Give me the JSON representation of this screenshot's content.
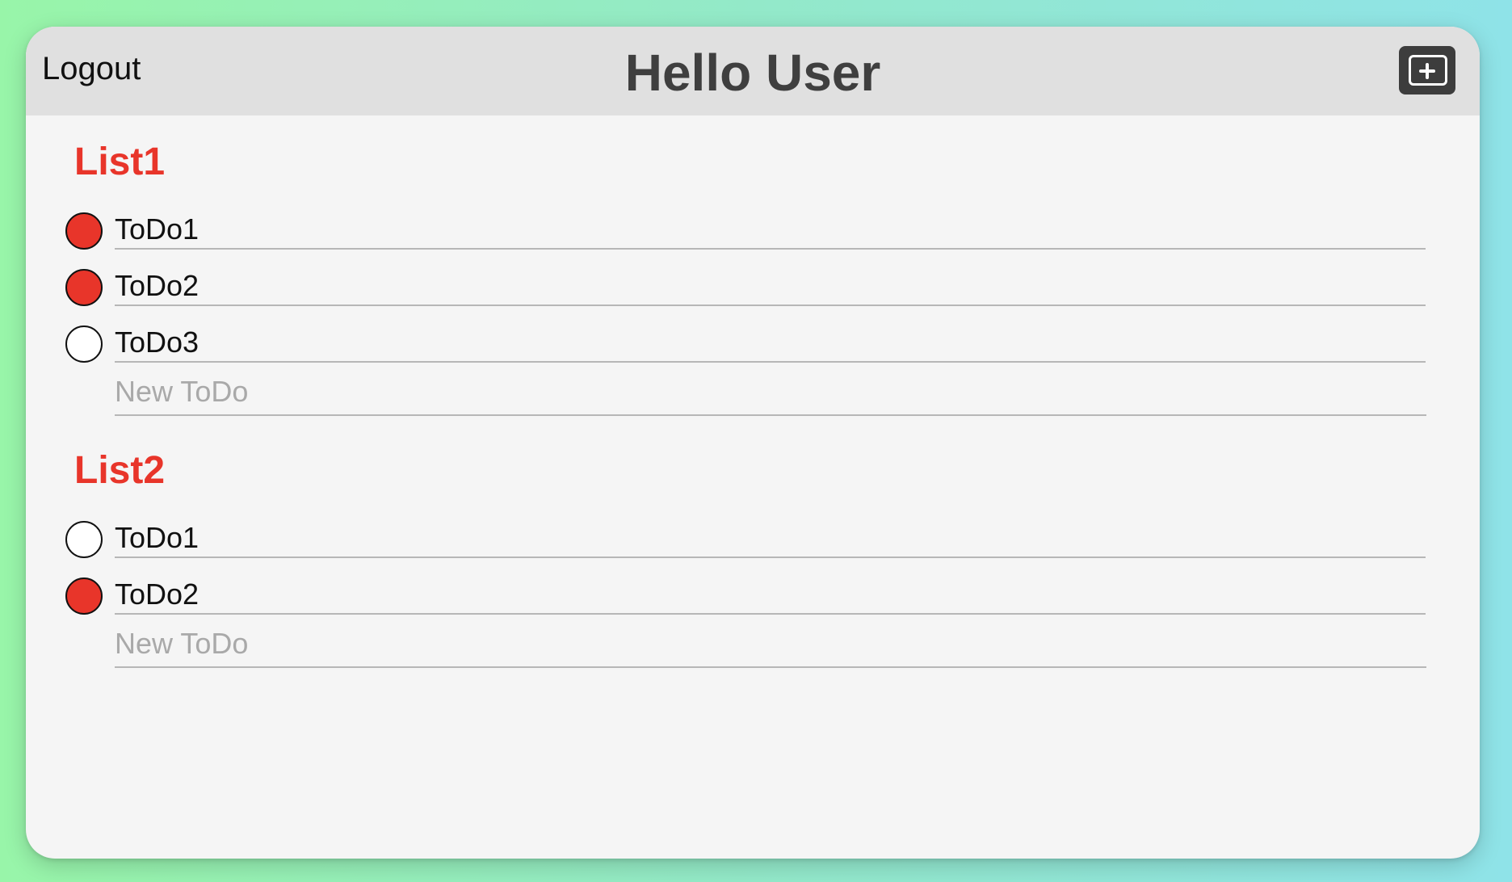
{
  "header": {
    "logout_label": "Logout",
    "title": "Hello User",
    "add_icon": "add-list-icon"
  },
  "lists": [
    {
      "title": "List1",
      "todos": [
        {
          "label": "ToDo1",
          "done": true
        },
        {
          "label": "ToDo2",
          "done": true
        },
        {
          "label": "ToDo3",
          "done": false
        }
      ],
      "new_placeholder": "New ToDo"
    },
    {
      "title": "List2",
      "todos": [
        {
          "label": "ToDo1",
          "done": false
        },
        {
          "label": "ToDo2",
          "done": true
        }
      ],
      "new_placeholder": "New ToDo"
    }
  ],
  "colors": {
    "accent": "#e8352a",
    "header_bg": "#e0e0e0",
    "panel_bg": "#f5f5f5",
    "title_text": "#3f3f3f",
    "button_bg": "#3d3d3d"
  }
}
